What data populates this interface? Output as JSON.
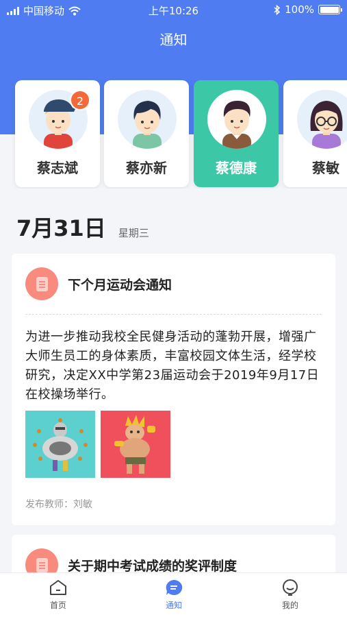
{
  "status_bar": {
    "carrier": "中国移动",
    "time": "上午10:26",
    "battery_text": "100%"
  },
  "nav": {
    "title": "通知"
  },
  "contacts": [
    {
      "name": "蔡志斌",
      "badge": "2",
      "selected": false
    },
    {
      "name": "蔡亦新",
      "selected": false
    },
    {
      "name": "蔡德康",
      "selected": true
    },
    {
      "name": "蔡敏",
      "selected": false
    }
  ],
  "date": {
    "day": "7月31日",
    "weekday": "星期三"
  },
  "notices": [
    {
      "title": "下个月运动会通知",
      "body": "为进一步推动我校全民健身活动的蓬勃开展，增强广大师生员工的身体素质，丰富校园文体生活，经学校研究，决定XX中学第23届运动会于2019年9月17日在校操场举行。",
      "publisher": "发布教师：刘敏"
    },
    {
      "title": "关于期中考试成绩的奖评制度"
    }
  ],
  "tabs": [
    {
      "label": "首页",
      "icon": "home-icon"
    },
    {
      "label": "通知",
      "icon": "message-icon",
      "active": true
    },
    {
      "label": "我的",
      "icon": "profile-icon"
    }
  ],
  "colors": {
    "primary": "#4f7cf0",
    "selected_card": "#3cc8a6",
    "badge": "#f26a3a",
    "doc_icon": "#f88a7e"
  }
}
